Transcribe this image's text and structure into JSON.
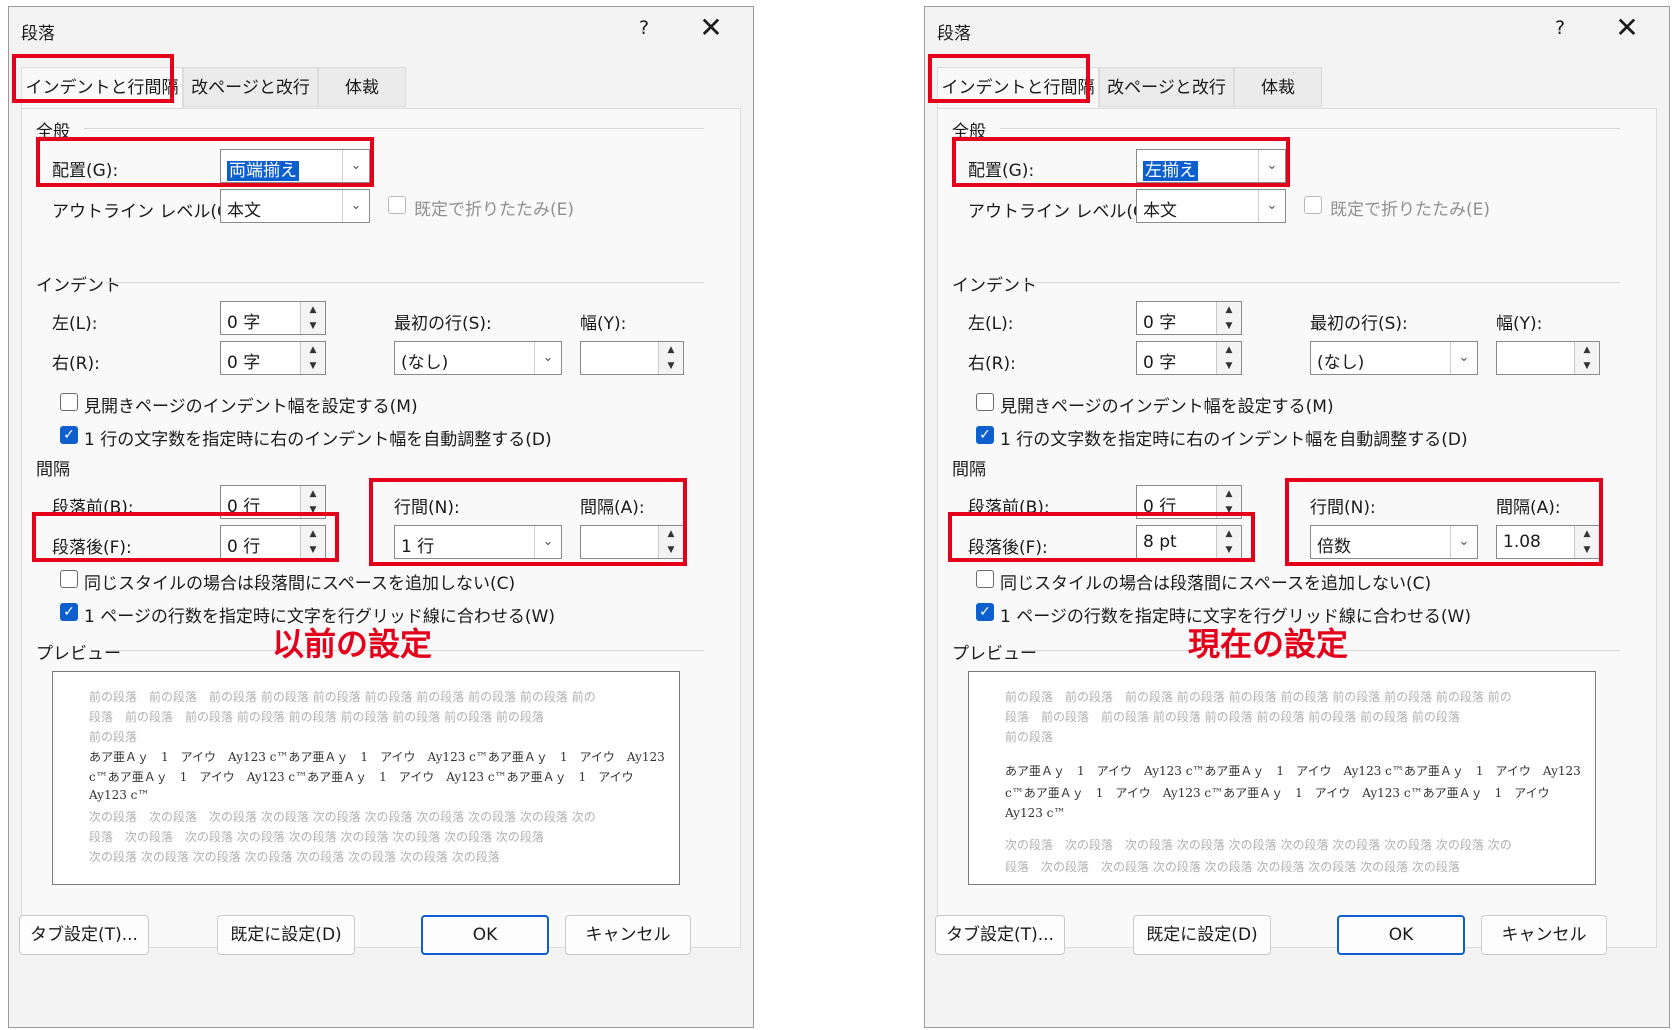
{
  "dialogs": [
    {
      "title": "段落",
      "help": "?",
      "close": "✕",
      "tabs": [
        "インデントと行間隔",
        "改ページと改行",
        "体裁"
      ],
      "general": {
        "heading": "全般",
        "alignment_label": "配置(G):",
        "alignment_value": "両端揃え",
        "outline_label": "アウトライン レベル(O):",
        "outline_value": "本文",
        "collapse_label": "既定で折りたたみ(E)"
      },
      "indent": {
        "heading": "インデント",
        "left_label": "左(L):",
        "left_value": "0 字",
        "right_label": "右(R):",
        "right_value": "0 字",
        "first_line_label": "最初の行(S):",
        "first_line_value": "(なし)",
        "width_label": "幅(Y):",
        "width_value": "",
        "mirror_label": "見開きページのインデント幅を設定する(M)",
        "auto_adjust_label": "1 行の文字数を指定時に右のインデント幅を自動調整する(D)"
      },
      "spacing": {
        "heading": "間隔",
        "before_label": "段落前(B):",
        "before_value": "0 行",
        "after_label": "段落後(F):",
        "after_value": "0 行",
        "line_spacing_label": "行間(N):",
        "line_spacing_value": "1 行",
        "at_label": "間隔(A):",
        "at_value": "",
        "no_space_label": "同じスタイルの場合は段落間にスペースを追加しない(C)",
        "snap_grid_label": "1 ページの行数を指定時に文字を行グリッド線に合わせる(W)"
      },
      "preview": {
        "heading": "プレビュー",
        "prev_lines": [
          "前の段落　前の段落　前の段落 前の段落 前の段落 前の段落 前の段落 前の段落 前の段落 前の",
          "段落　前の段落　前の段落 前の段落 前の段落 前の段落 前の段落 前の段落 前の段落",
          "前の段落"
        ],
        "sample_lines": [
          "あア亜Ａｙ　1　アイウ　Ay123 c™あア亜Ａｙ　1　アイウ　Ay123 c™あア亜Ａｙ　1　アイウ　Ay123",
          "c™あア亜Ａｙ　1　アイウ　Ay123 c™あア亜Ａｙ　1　アイウ　Ay123 c™あア亜Ａｙ　1　アイウ",
          "Ay123 c™"
        ],
        "next_lines": [
          "次の段落　次の段落　次の段落 次の段落 次の段落 次の段落 次の段落 次の段落 次の段落 次の",
          "段落　次の段落　次の段落 次の段落 次の段落 次の段落 次の段落 次の段落 次の段落",
          "次の段落 次の段落 次の段落 次の段落 次の段落 次の段落 次の段落 次の段落"
        ]
      },
      "annotation": "以前の設定",
      "buttons": {
        "tabs": "タブ設定(T)...",
        "default": "既定に設定(D)",
        "ok": "OK",
        "cancel": "キャンセル"
      }
    },
    {
      "title": "段落",
      "help": "?",
      "close": "✕",
      "tabs": [
        "インデントと行間隔",
        "改ページと改行",
        "体裁"
      ],
      "general": {
        "heading": "全般",
        "alignment_label": "配置(G):",
        "alignment_value": "左揃え",
        "outline_label": "アウトライン レベル(O):",
        "outline_value": "本文",
        "collapse_label": "既定で折りたたみ(E)"
      },
      "indent": {
        "heading": "インデント",
        "left_label": "左(L):",
        "left_value": "0 字",
        "right_label": "右(R):",
        "right_value": "0 字",
        "first_line_label": "最初の行(S):",
        "first_line_value": "(なし)",
        "width_label": "幅(Y):",
        "width_value": "",
        "mirror_label": "見開きページのインデント幅を設定する(M)",
        "auto_adjust_label": "1 行の文字数を指定時に右のインデント幅を自動調整する(D)"
      },
      "spacing": {
        "heading": "間隔",
        "before_label": "段落前(B):",
        "before_value": "0 行",
        "after_label": "段落後(F):",
        "after_value": "8 pt",
        "line_spacing_label": "行間(N):",
        "line_spacing_value": "倍数",
        "at_label": "間隔(A):",
        "at_value": "1.08",
        "no_space_label": "同じスタイルの場合は段落間にスペースを追加しない(C)",
        "snap_grid_label": "1 ページの行数を指定時に文字を行グリッド線に合わせる(W)"
      },
      "preview": {
        "heading": "プレビュー",
        "prev_lines": [
          "前の段落　前の段落　前の段落 前の段落 前の段落 前の段落 前の段落 前の段落 前の段落 前の",
          "段落　前の段落　前の段落 前の段落 前の段落 前の段落 前の段落 前の段落 前の段落",
          "前の段落"
        ],
        "sample_lines": [
          "あア亜Ａｙ　1　アイウ　Ay123 c™あア亜Ａｙ　1　アイウ　Ay123 c™あア亜Ａｙ　1　アイウ　Ay123",
          "c™あア亜Ａｙ　1　アイウ　Ay123 c™あア亜Ａｙ　1　アイウ　Ay123 c™あア亜Ａｙ　1　アイウ",
          "Ay123 c™"
        ],
        "next_lines": [
          "次の段落　次の段落　次の段落 次の段落 次の段落 次の段落 次の段落 次の段落 次の段落 次の",
          "段落　次の段落　次の段落 次の段落 次の段落 次の段落 次の段落 次の段落 次の段落",
          "次の段落 次の段落 次の段落 次の段落 次の段落 次の段落 次の段落 次の段落"
        ]
      },
      "annotation": "現在の設定",
      "buttons": {
        "tabs": "タブ設定(T)...",
        "default": "既定に設定(D)",
        "ok": "OK",
        "cancel": "キャンセル"
      }
    }
  ],
  "colors": {
    "highlight_box": "#e4001b",
    "selection": "#0c5fcd",
    "dialog_bg": "#f3f3f3"
  }
}
